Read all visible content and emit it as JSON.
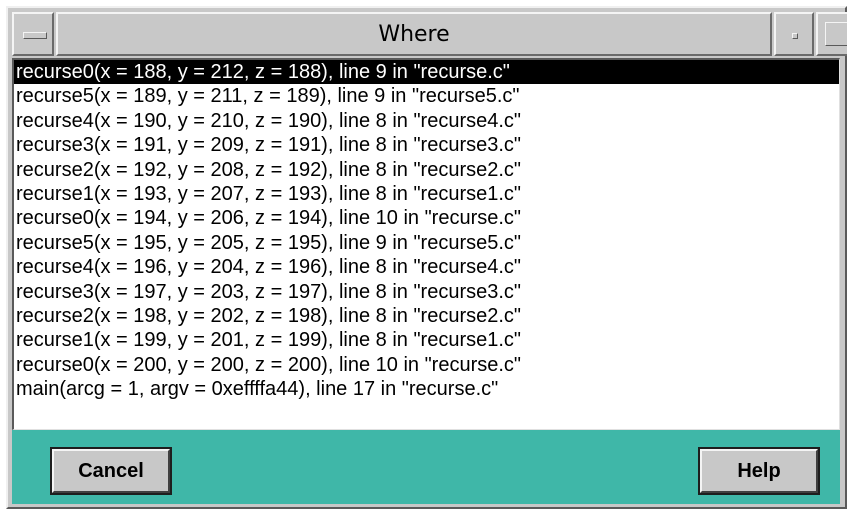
{
  "window": {
    "title": "Where"
  },
  "stack": {
    "frames": [
      "recurse0(x = 188, y = 212, z = 188), line 9 in \"recurse.c\"",
      "recurse5(x = 189, y = 211, z = 189), line 9 in \"recurse5.c\"",
      "recurse4(x = 190, y = 210, z = 190), line 8 in \"recurse4.c\"",
      "recurse3(x = 191, y = 209, z = 191), line 8 in \"recurse3.c\"",
      "recurse2(x = 192, y = 208, z = 192), line 8 in \"recurse2.c\"",
      "recurse1(x = 193, y = 207, z = 193), line 8 in \"recurse1.c\"",
      "recurse0(x = 194, y = 206, z = 194), line 10 in \"recurse.c\"",
      "recurse5(x = 195, y = 205, z = 195), line 9 in \"recurse5.c\"",
      "recurse4(x = 196, y = 204, z = 196), line 8 in \"recurse4.c\"",
      "recurse3(x = 197, y = 203, z = 197), line 8 in \"recurse3.c\"",
      "recurse2(x = 198, y = 202, z = 198), line 8 in \"recurse2.c\"",
      "recurse1(x = 199, y = 201, z = 199), line 8 in \"recurse1.c\"",
      "recurse0(x = 200, y = 200, z = 200), line 10 in \"recurse.c\"",
      "main(arcg = 1, argv = 0xeffffa44), line 17 in \"recurse.c\""
    ],
    "selected_index": 0
  },
  "buttons": {
    "cancel_label": "Cancel",
    "help_label": "Help"
  },
  "colors": {
    "button_bar": "#3fb7a8",
    "selection": "#000000"
  }
}
